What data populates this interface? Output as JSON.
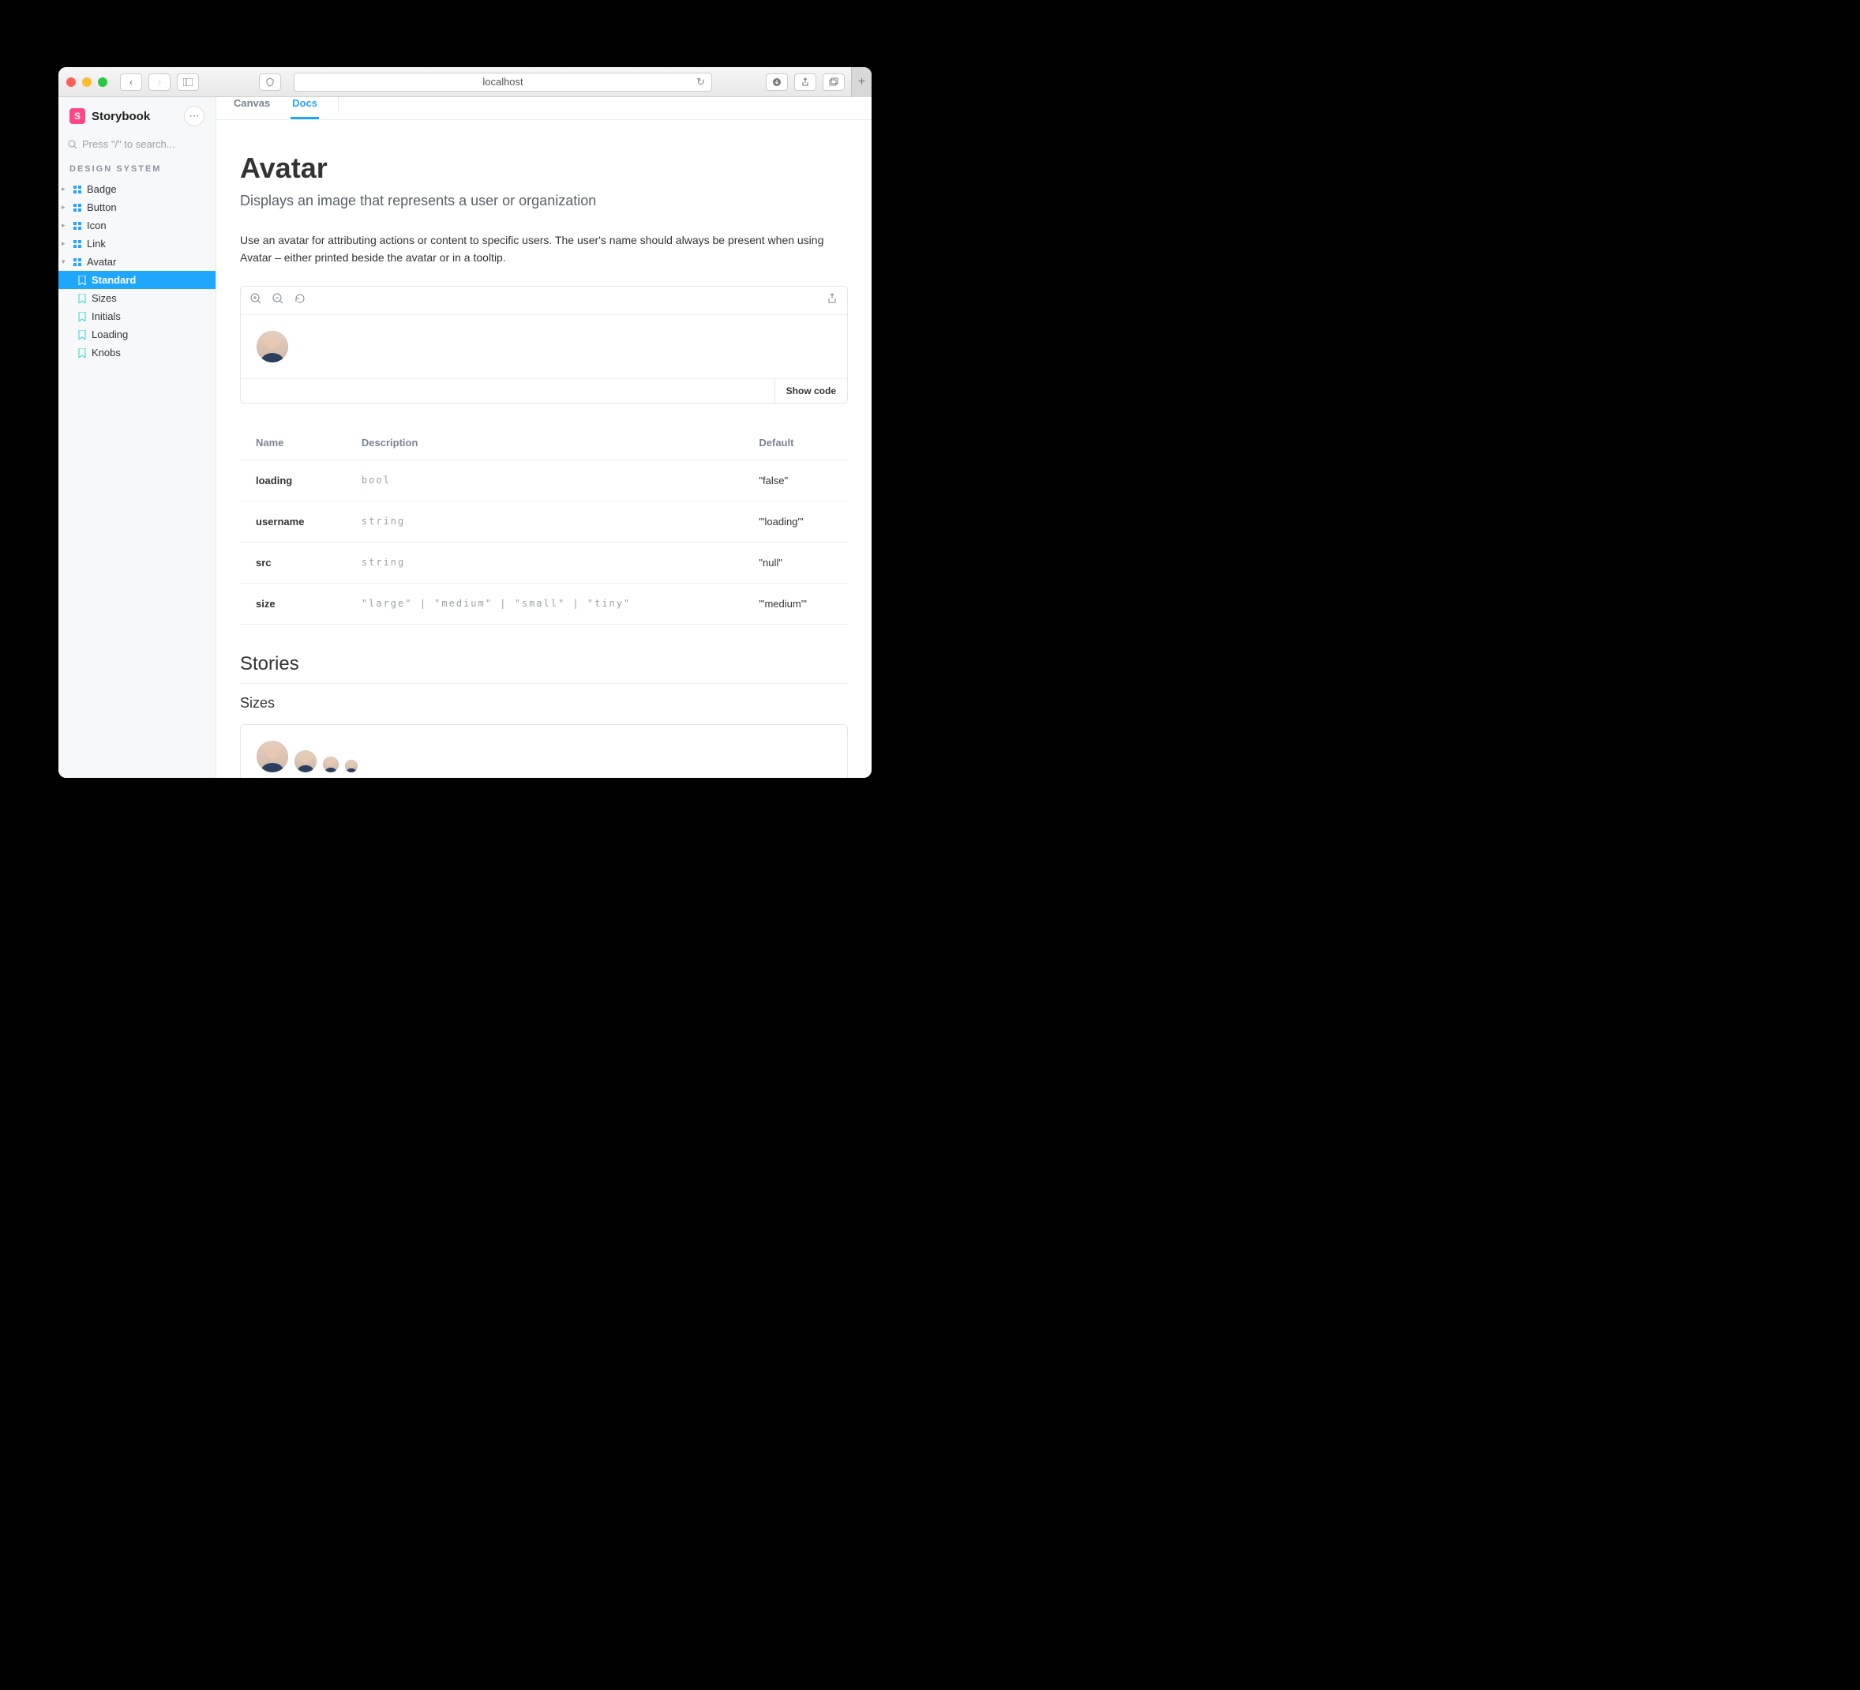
{
  "browser": {
    "address": "localhost",
    "traffic": [
      "close",
      "minimize",
      "zoom"
    ]
  },
  "sidebar": {
    "brand": "Storybook",
    "search_placeholder": "Press \"/\" to search...",
    "section": "DESIGN SYSTEM",
    "items": [
      {
        "label": "Badge",
        "type": "component",
        "expanded": false
      },
      {
        "label": "Button",
        "type": "component",
        "expanded": false
      },
      {
        "label": "Icon",
        "type": "component",
        "expanded": false
      },
      {
        "label": "Link",
        "type": "component",
        "expanded": false
      },
      {
        "label": "Avatar",
        "type": "component",
        "expanded": true,
        "children": [
          {
            "label": "Standard",
            "selected": true
          },
          {
            "label": "Sizes"
          },
          {
            "label": "Initials"
          },
          {
            "label": "Loading"
          },
          {
            "label": "Knobs"
          }
        ]
      }
    ]
  },
  "tabs": [
    {
      "label": "Canvas",
      "active": false
    },
    {
      "label": "Docs",
      "active": true
    }
  ],
  "doc": {
    "title": "Avatar",
    "subtitle": "Displays an image that represents a user or organization",
    "body": "Use an avatar for attributing actions or content to specific users. The user's name should always be present when using Avatar – either printed beside the avatar or in a tooltip.",
    "show_code_label": "Show code",
    "stories_heading": "Stories",
    "sizes_heading": "Sizes"
  },
  "props": {
    "headers": {
      "name": "Name",
      "description": "Description",
      "default": "Default"
    },
    "rows": [
      {
        "name": "loading",
        "description": "bool",
        "default": "\"false\""
      },
      {
        "name": "username",
        "description": "string",
        "default": "\"'loading'\""
      },
      {
        "name": "src",
        "description": "string",
        "default": "\"null\""
      },
      {
        "name": "size",
        "description": "\"large\" | \"medium\" | \"small\" | \"tiny\"",
        "default": "\"'medium'\""
      }
    ]
  }
}
